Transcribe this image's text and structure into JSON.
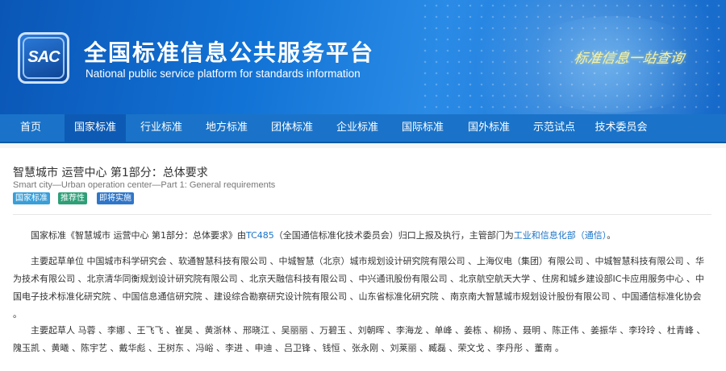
{
  "header": {
    "logo_text": "SAC",
    "title_cn": "全国标准信息公共服务平台",
    "title_en": "National public service platform  for standards information",
    "slogan": "标准信息一站查询"
  },
  "nav": {
    "items": [
      {
        "label": "首页"
      },
      {
        "label": "国家标准"
      },
      {
        "label": "行业标准"
      },
      {
        "label": "地方标准"
      },
      {
        "label": "团体标准"
      },
      {
        "label": "企业标准"
      },
      {
        "label": "国际标准"
      },
      {
        "label": "国外标准"
      },
      {
        "label": "示范试点"
      },
      {
        "label": "技术委员会"
      }
    ],
    "active_index": 1
  },
  "standard": {
    "title_cn": "智慧城市 运营中心 第1部分：总体要求",
    "title_en": "Smart city—Urban operation center—Part 1: General requirements",
    "badges": [
      {
        "label": "国家标准",
        "color": "#3a9fd8"
      },
      {
        "label": "推荐性",
        "color": "#2f9f78"
      },
      {
        "label": "即将实施",
        "color": "#2f76c9"
      }
    ]
  },
  "summary": {
    "p1_before": "国家标准《智慧城市 运营中心 第1部分：总体要求》由",
    "tc_link": "TC485",
    "p1_mid": "（全国通信标准化技术委员会）归口上报及执行，主管部门为",
    "dept_link": "工业和信息化部（通信）",
    "p1_after": "。",
    "drafting_units": "主要起草单位 中国城市科学研究会 、软通智慧科技有限公司 、中城智慧（北京）城市规划设计研究院有限公司 、上海仪电（集团）有限公司 、中城智慧科技有限公司 、华为技术有限公司 、北京清华同衡规划设计研究院有限公司 、北京天融信科技有限公司 、中兴通讯股份有限公司 、北京航空航天大学 、住房和城乡建设部IC卡应用服务中心 、中国电子技术标准化研究院 、中国信息通信研究院 、建设综合勘察研究设计院有限公司 、山东省标准化研究院 、南京南大智慧城市规划设计股份有限公司 、中国通信标准化协会 。",
    "drafters": "主要起草人 马蓉 、李娜 、王飞飞 、崔昊 、黄浙林 、邢晓江 、吴丽丽 、万碧玉 、刘朝晖 、李海龙 、单峰 、姜栋 、柳扬 、聂明 、陈正伟 、姜振华 、李玲玲 、杜青峰 、隗玉凯 、黄曦 、陈宇艺 、戴华彪 、王树东 、冯峪 、李进 、申迪 、吕卫锋 、钱恒 、张永刚 、刘莱丽 、臧磊 、荣文戈 、李丹彤 、董南 。"
  }
}
